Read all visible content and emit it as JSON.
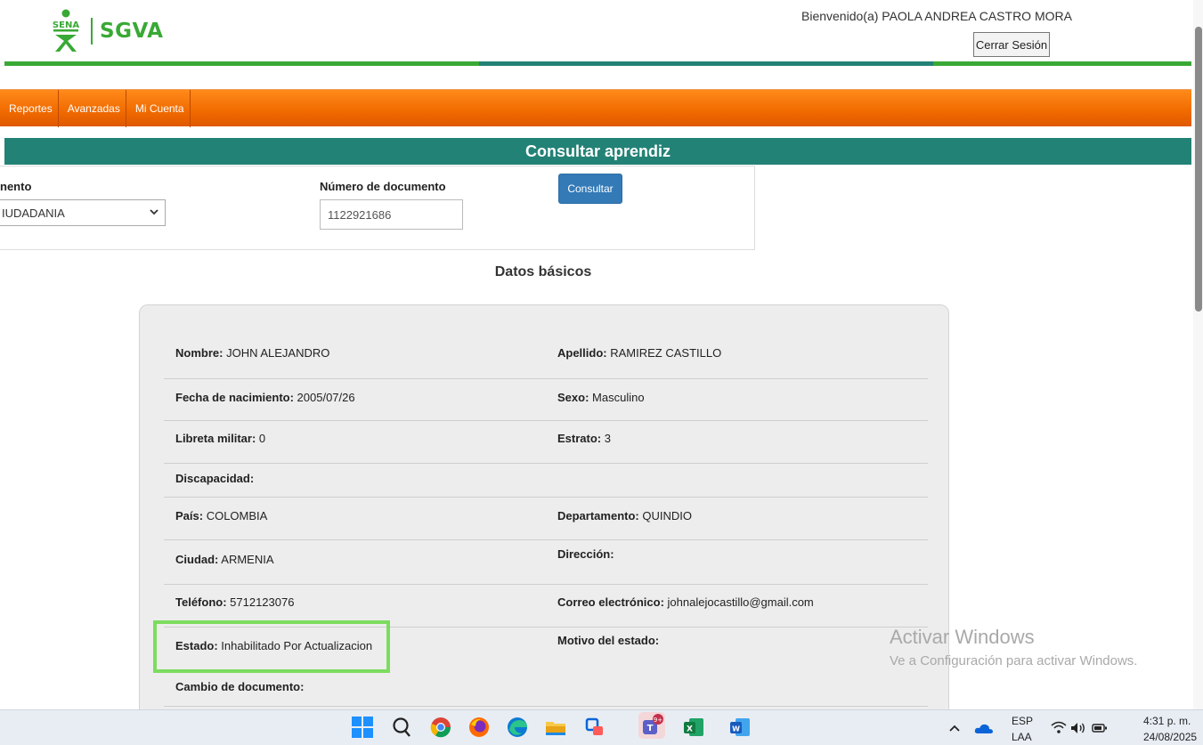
{
  "header": {
    "logo_brand": "SENA",
    "app_name": "SGVA",
    "welcome": "Bienvenido(a) PAOLA ANDREA CASTRO MORA",
    "logout_label": "Cerrar Sesión"
  },
  "menu": {
    "items": [
      "Reportes",
      "Avanzadas",
      "Mi Cuenta"
    ]
  },
  "section": {
    "title": "Consultar aprendiz"
  },
  "search": {
    "doc_type_label": "nento",
    "doc_type_value": "IUDADANIA",
    "doc_number_label": "Número de documento",
    "doc_number_value": "1122921686",
    "consult_label": "Consultar"
  },
  "basic_data": {
    "title": "Datos básicos",
    "nombre_label": "Nombre:",
    "nombre": "JOHN ALEJANDRO",
    "apellido_label": "Apellido:",
    "apellido": "RAMIREZ CASTILLO",
    "fecha_label": "Fecha de nacimiento:",
    "fecha": "2005/07/26",
    "sexo_label": "Sexo:",
    "sexo": "Masculino",
    "libreta_label": "Libreta militar:",
    "libreta": "0",
    "estrato_label": "Estrato:",
    "estrato": "3",
    "discapacidad_label": "Discapacidad:",
    "pais_label": "País:",
    "pais": "COLOMBIA",
    "departamento_label": "Departamento:",
    "departamento": "QUINDIO",
    "ciudad_label": "Ciudad:",
    "ciudad": "ARMENIA",
    "direccion_label": "Dirección:",
    "telefono_label": "Teléfono:",
    "telefono": "5712123076",
    "correo_label": "Correo electrónico:",
    "correo": "johnalejocastillo@gmail.com",
    "estado_label": "Estado:",
    "estado": "Inhabilitado Por Actualizacion",
    "motivo_label": "Motivo del estado:",
    "cambio_label": "Cambio de documento:"
  },
  "watermark": {
    "line1": "Activar Windows",
    "line2": "Ve a Configuración para activar Windows."
  },
  "taskbar": {
    "teams_badge": "9+",
    "lang_top": "ESP",
    "lang_bottom": "LAA",
    "time": "4:31 p. m.",
    "date": "24/08/2025"
  },
  "colors": {
    "sena_green": "#39a935",
    "teal": "#238276",
    "orange": "#f06a00",
    "button_blue": "#337ab7",
    "highlight_green": "#7ddc5e"
  }
}
